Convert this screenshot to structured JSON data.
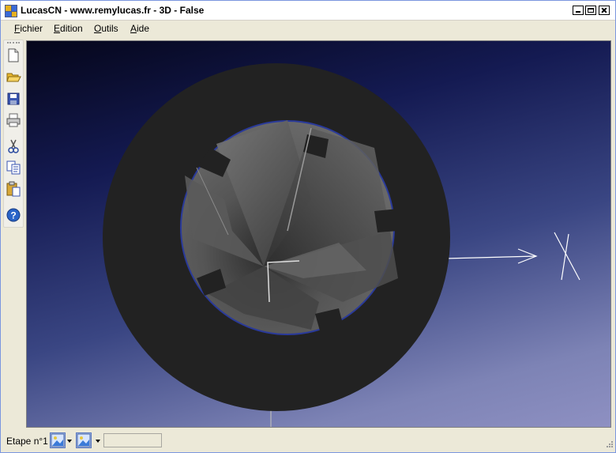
{
  "window": {
    "title": "LucasCN - www.remylucas.fr - 3D - False"
  },
  "menu": [
    {
      "label": "Fichier",
      "accel": "F",
      "rest": "ichier"
    },
    {
      "label": "Edition",
      "accel": "E",
      "rest": "dition"
    },
    {
      "label": "Outils",
      "accel": "O",
      "rest": "utils"
    },
    {
      "label": "Aide",
      "accel": "A",
      "rest": "ide"
    }
  ],
  "toolbar": {
    "buttons": [
      "new-file-icon",
      "open-folder-icon",
      "save-icon",
      "print-icon",
      "cut-icon",
      "copy-icon",
      "paste-icon",
      "help-icon"
    ]
  },
  "viewport": {
    "background_top": "#05061a",
    "background_bottom": "#8e90c2",
    "part_color": "#222222",
    "bore_outline_color": "#2a3a9a",
    "axis_color": "#ffffff"
  },
  "status": {
    "step_label": "Etape n°1",
    "step_field_value": ""
  }
}
